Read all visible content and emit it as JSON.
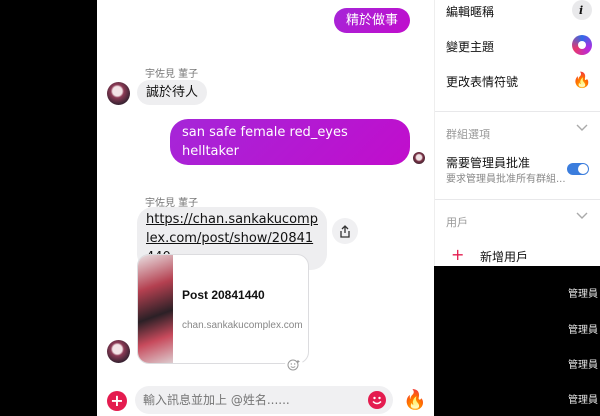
{
  "chat": {
    "messages": {
      "top_outgoing": "精於做事",
      "sender1": "宇佐見 菫子",
      "incoming1": "誠於待人",
      "outgoing2": "san safe female red_eyes helltaker",
      "sender2": "宇佐見 菫子",
      "link_text": "https://chan.sankakucomplex.com/post/show/20841440",
      "card_title": "Post 20841440",
      "card_domain": "chan.sankakucomplex.com"
    },
    "composer": {
      "placeholder": "輸入訊息並加上 @姓名......"
    }
  },
  "sidebar": {
    "items": [
      {
        "label": "編輯暱稱",
        "icon": "pencil-icon"
      },
      {
        "label": "變更主題",
        "icon": "theme-icon"
      },
      {
        "label": "更改表情符號",
        "icon": "fire-emoji-icon"
      }
    ],
    "group_options": {
      "title": "群組選項",
      "approval_title": "需要管理員批准",
      "approval_desc": "要求管理員批准所有群組...",
      "approval_on": true
    },
    "members": {
      "title": "用戶",
      "add_label": "新增用戶",
      "admin_tags": [
        "管理員",
        "管理員",
        "管理員",
        "管理員"
      ]
    }
  },
  "colors": {
    "accent": "#c10dcc",
    "action": "#e41c4f",
    "toggle": "#3b7ddd"
  }
}
